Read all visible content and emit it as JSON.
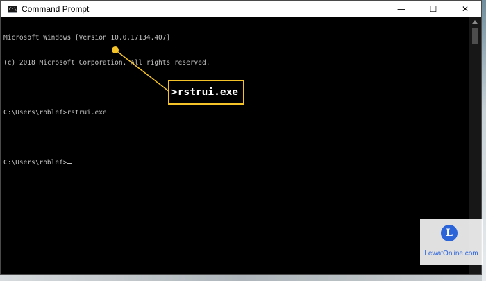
{
  "window": {
    "title": "Command Prompt",
    "controls": {
      "minimize": "—",
      "maximize": "☐",
      "close": "✕"
    }
  },
  "console": {
    "lines": [
      "Microsoft Windows [Version 10.0.17134.407]",
      "(c) 2018 Microsoft Corporation. All rights reserved.",
      "",
      "C:\\Users\\roblef>rstrui.exe",
      "",
      "C:\\Users\\roblef>"
    ]
  },
  "callout": {
    "text": ">rstrui.exe",
    "color": "#f4c32a"
  },
  "watermark": {
    "badge": "L",
    "text": "LewatOnline.com"
  }
}
